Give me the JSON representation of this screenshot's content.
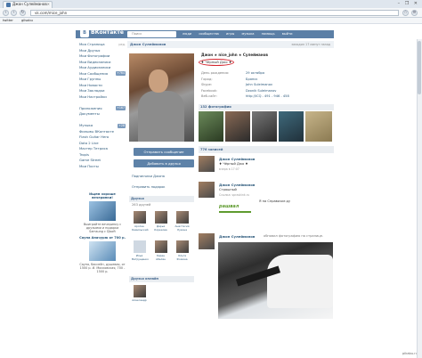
{
  "browser": {
    "tab_title": "Джон Сулейманов",
    "address": "vk.com/mice_john",
    "window_controls": "– ❐ ✕",
    "bookmarks": [
      "twitter",
      "gilsabu"
    ]
  },
  "vk": {
    "logo_text": "ВКонтакте",
    "logo_letter": "В",
    "search_placeholder": "Поиск",
    "top_nav": [
      "люди",
      "сообщества",
      "игры",
      "музыка",
      "помощь",
      "выйти"
    ],
    "page_header": "Джон Сулейманов",
    "last_seen": "заходил 17 минут назад"
  },
  "left_menu": [
    {
      "label": "Моя Страница",
      "extra": "ред."
    },
    {
      "label": "Мои Друзья",
      "extra": ""
    },
    {
      "label": "Мои Фотографии",
      "extra": ""
    },
    {
      "label": "Мои Видеозаписи",
      "extra": ""
    },
    {
      "label": "Мои Аудиозаписи",
      "extra": ""
    },
    {
      "label": "Мои Сообщения",
      "extra": "+764"
    },
    {
      "label": "Мои Группы",
      "extra": ""
    },
    {
      "label": "Мои Новости",
      "extra": ""
    },
    {
      "label": "Мои Закладки",
      "extra": ""
    },
    {
      "label": "Мои Настройки",
      "extra": ""
    },
    {
      "label": "",
      "extra": ""
    },
    {
      "label": "Приложения",
      "extra": "+167"
    },
    {
      "label": "Документы",
      "extra": ""
    },
    {
      "label": "",
      "extra": ""
    },
    {
      "label": "Музыка",
      "extra": "+28"
    },
    {
      "label": "Фильмы ВКонтакте",
      "extra": ""
    },
    {
      "label": "Flash Guitar Hero",
      "extra": ""
    },
    {
      "label": "Dota 2 Live",
      "extra": ""
    },
    {
      "label": "Мастер Тетриса",
      "extra": ""
    },
    {
      "label": "Tropis",
      "extra": ""
    },
    {
      "label": "Game Street",
      "extra": ""
    },
    {
      "label": "Мои Посты",
      "extra": ""
    }
  ],
  "ads": [
    {
      "title": "Ищем хороше вечеринки!",
      "text": "Выиграйте вечеринку с друзьями и подарки Samsung с Djsoft"
    },
    {
      "title": "Сауна Апачурю от 700 р.",
      "text": "Сауна, бассейн, душевая, от 1500 р. И. Московская, 700 - 1500 р."
    }
  ],
  "profile": {
    "name_line": "Джон ★ nice_john ★ Сулейманов",
    "status": "♦ Чёрный Джо ♦",
    "send_message": "Отправить сообщение",
    "add_friend": "Добавить в друзья",
    "subscribers_link": "Подписчики Джона",
    "gift_link": "Отправить подарок",
    "info_rows": [
      {
        "label": "День рождения:",
        "value": "29 октября"
      },
      {
        "label": "Город:",
        "value": "Брянск"
      },
      {
        "label": "Skype:",
        "value": "John Suleimanov"
      },
      {
        "label": "Facebook:",
        "value": "Dzonik Suleimanov"
      },
      {
        "label": "Веб-сайт:",
        "value": "http://ICQ - 491 - 946 - 458"
      }
    ],
    "photos_header": "132 фотографии",
    "friends_header": "Друзья",
    "friends_count": "263 друзей",
    "friends": [
      {
        "name": "Арслан Камильский"
      },
      {
        "name": "Дарья Корекова"
      },
      {
        "name": "Анастасия Лукина"
      },
      {
        "name": "Илья Ватрущенко"
      },
      {
        "name": "Карен Абелян"
      },
      {
        "name": "Ольга Фомина"
      }
    ],
    "online_header": "Друзья онлайн",
    "online_friend": "Александр"
  },
  "wall": {
    "header": "776 записей",
    "posts": [
      {
        "author": "Джон Сулейманов",
        "text": "♦ Чёрный Джо ♦",
        "date": "вчера в 17:07"
      },
      {
        "author": "Джон Сулейманов",
        "text": "Страшный",
        "link": "Ссылка: spraskink.ru",
        "site_title": "Я на Справочке.ру",
        "site_logo": "рашвал"
      },
      {
        "author": "Джон Сулейманов",
        "text": "обновил фотографию на странице."
      }
    ],
    "watermark": "pikabu.ru"
  },
  "colors": {
    "vk_blue": "#5b7fa6",
    "link": "#2b587a",
    "status_circle": "#d4242d"
  }
}
